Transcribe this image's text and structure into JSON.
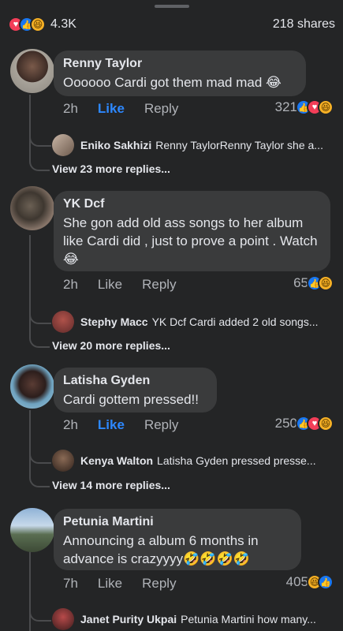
{
  "summary": {
    "reaction_count": "4.3K",
    "shares": "218 shares",
    "reactions": [
      "heart-icon",
      "like-icon",
      "haha-icon"
    ]
  },
  "comments": [
    {
      "name": "Renny Taylor",
      "text": "Oooooo Cardi got them mad mad 😂",
      "time": "2h",
      "like": "Like",
      "reply": "Reply",
      "liked": true,
      "reaction_count": "321",
      "reactions": [
        "like",
        "heart",
        "haha"
      ],
      "reply_preview": {
        "name": "Eniko Sakhizi",
        "text": "Renny TaylorRenny Taylor she a..."
      },
      "more_replies": "View 23 more replies..."
    },
    {
      "name": "YK Dcf",
      "text": "She gon add old ass songs to her album like Cardi did , just to prove a point . Watch 😂",
      "time": "2h",
      "like": "Like",
      "reply": "Reply",
      "liked": false,
      "reaction_count": "65",
      "reactions": [
        "like",
        "haha"
      ],
      "reply_preview": {
        "name": "Stephy Macc",
        "text": "YK Dcf Cardi added 2 old songs..."
      },
      "more_replies": "View 20 more replies..."
    },
    {
      "name": "Latisha Gyden",
      "text": "Cardi gottem pressed!!",
      "time": "2h",
      "like": "Like",
      "reply": "Reply",
      "liked": true,
      "reaction_count": "250",
      "reactions": [
        "like",
        "heart",
        "haha"
      ],
      "reply_preview": {
        "name": "Kenya Walton",
        "text": "Latisha Gyden pressed presse..."
      },
      "more_replies": "View 14 more replies..."
    },
    {
      "name": "Petunia Martini",
      "text": "Announcing a album 6 months in advance is crazyyyy🤣🤣🤣🤣",
      "time": "7h",
      "like": "Like",
      "reply": "Reply",
      "liked": false,
      "reaction_count": "405",
      "reactions": [
        "haha",
        "like"
      ],
      "reply_preview": {
        "name": "Janet Purity Ukpai",
        "text": "Petunia Martini how many..."
      }
    }
  ],
  "colors": {
    "like_blue": "#1877f2",
    "heart_red": "#f33e58",
    "haha_yellow": "#f7b125",
    "bubble": "#3a3b3c",
    "background": "#242526"
  }
}
